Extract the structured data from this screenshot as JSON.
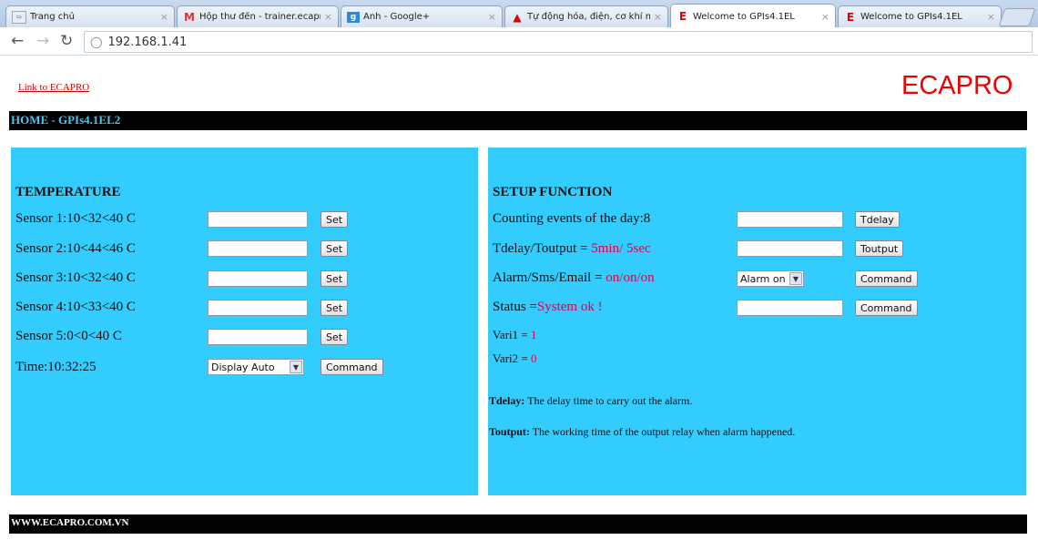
{
  "browser": {
    "tabs": [
      {
        "title": "Trang chủ",
        "active": false
      },
      {
        "title": "Hộp thư đến - trainer.ecapro",
        "active": false
      },
      {
        "title": "Ảnh - Google+",
        "active": false
      },
      {
        "title": "Tự động hóa, điện, cơ khí máy",
        "active": false
      },
      {
        "title": "Welcome to GPIs4.1EL",
        "active": true
      },
      {
        "title": "Welcome to GPIs4.1EL",
        "active": false
      }
    ],
    "close_glyph": "×",
    "url": "192.168.1.41"
  },
  "header": {
    "link_text": "Link to ECAPRO",
    "brand": "ECAPRO",
    "title": "HOME - GPIs4.1EL2"
  },
  "temperature": {
    "heading": "TEMPERATURE",
    "sensors": [
      {
        "label": "Sensor 1:10<32<40 C",
        "button": "Set"
      },
      {
        "label": "Sensor 2:10<44<46 C",
        "button": "Set"
      },
      {
        "label": "Sensor 3:10<32<40 C",
        "button": "Set"
      },
      {
        "label": "Sensor 4:10<33<40 C",
        "button": "Set"
      },
      {
        "label": "Sensor 5:0<0<40 C",
        "button": "Set"
      }
    ],
    "time_label": "Time:10:32:25",
    "display_select": "Display Auto",
    "command_button": "Command"
  },
  "setup": {
    "heading": "SETUP FUNCTION",
    "counting_label": "Counting events of the day:8",
    "tdelay_button": "Tdelay",
    "tdelay_label": "Tdelay/Toutput = ",
    "tdelay_value": "5min/ 5sec",
    "toutput_button": "Toutput",
    "alarm_label": "Alarm/Sms/Email = ",
    "alarm_value": "on/on/on",
    "alarm_select": "Alarm on",
    "alarm_command": "Command",
    "status_label": "Status =",
    "status_value": "System ok !",
    "status_command": "Command",
    "vari1_label": "Vari1 = ",
    "vari1_value": "1",
    "vari2_label": "Vari2 = ",
    "vari2_value": "0",
    "note1_key": "Tdelay:",
    "note1_text": " The delay time to carry out the alarm.",
    "note2_key": "Toutput:",
    "note2_text": " The working time of the output relay when alarm happened."
  },
  "footer": {
    "text": "WWW.ECAPRO.COM.VN"
  },
  "colors": {
    "panel": "#33ccff",
    "brand": "#ee0000",
    "value_red": "#e0004a",
    "title_cyan": "#4ec5f0"
  }
}
